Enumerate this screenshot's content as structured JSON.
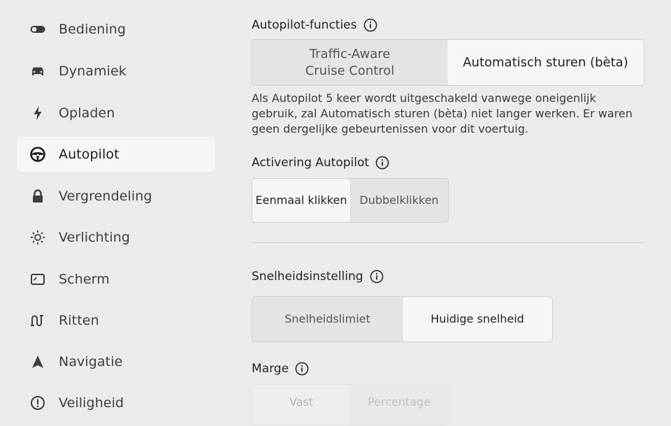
{
  "sidebar": {
    "items": [
      {
        "label": "Bediening",
        "icon": "toggle-icon"
      },
      {
        "label": "Dynamiek",
        "icon": "car-icon"
      },
      {
        "label": "Opladen",
        "icon": "lightning-icon"
      },
      {
        "label": "Autopilot",
        "icon": "steering-wheel-icon",
        "active": true
      },
      {
        "label": "Vergrendeling",
        "icon": "lock-icon"
      },
      {
        "label": "Verlichting",
        "icon": "light-icon"
      },
      {
        "label": "Scherm",
        "icon": "display-icon"
      },
      {
        "label": "Ritten",
        "icon": "trips-icon"
      },
      {
        "label": "Navigatie",
        "icon": "navigation-arrow-icon"
      },
      {
        "label": "Veiligheid",
        "icon": "alert-icon"
      }
    ]
  },
  "autopilot_features": {
    "title": "Autopilot-functies",
    "options": [
      "Traffic-Aware\nCruise Control",
      "Automatisch sturen (bèta)"
    ],
    "selected": "Automatisch sturen (bèta)",
    "description": "Als Autopilot 5 keer wordt uitgeschakeld vanwege oneigenlijk gebruik, zal Automatisch sturen (bèta) niet langer werken. Er waren geen dergelijke gebeurtenissen voor dit voertuig."
  },
  "activation": {
    "title": "Activering Autopilot",
    "options": [
      "Eenmaal klikken",
      "Dubbelklikken"
    ],
    "selected": "Eenmaal klikken"
  },
  "speed_setting": {
    "title": "Snelheidsinstelling",
    "options": [
      "Snelheidslimiet",
      "Huidige snelheid"
    ],
    "selected": "Huidige snelheid"
  },
  "margin": {
    "title": "Marge",
    "options": [
      "Vast",
      "Percentage"
    ]
  },
  "colors": {
    "background": "#ebebeb",
    "selected_segment": "#f6f6f6",
    "text": "#2a2a2a"
  }
}
